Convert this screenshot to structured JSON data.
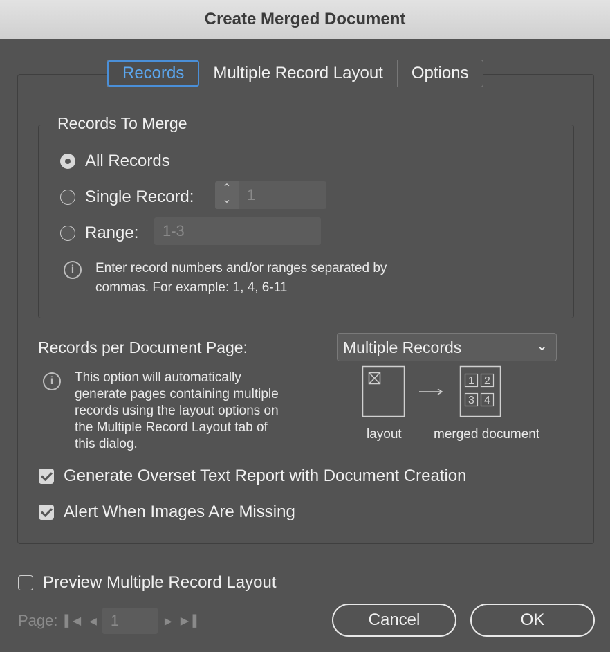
{
  "window": {
    "title": "Create Merged Document"
  },
  "tabs": [
    {
      "label": "Records",
      "active": true
    },
    {
      "label": "Multiple Record Layout",
      "active": false
    },
    {
      "label": "Options",
      "active": false
    }
  ],
  "records_group": {
    "title": "Records To Merge",
    "all_records": {
      "label": "All Records",
      "selected": true
    },
    "single_record": {
      "label": "Single Record:",
      "value": "1",
      "selected": false
    },
    "range": {
      "label": "Range:",
      "placeholder": "1-3",
      "selected": false
    },
    "info_line1": "Enter record numbers and/or ranges separated by",
    "info_line2": "commas. For example: 1, 4, 6-11"
  },
  "per_page": {
    "label": "Records per Document Page:",
    "selected": "Multiple Records",
    "info_lines": [
      "This option will automatically",
      "generate pages containing multiple",
      "records using the layout options on",
      "the Multiple Record Layout tab of",
      "this dialog."
    ],
    "diagram": {
      "layout_caption": "layout",
      "merged_caption": "merged document",
      "cells": [
        "1",
        "2",
        "3",
        "4"
      ]
    }
  },
  "checkboxes": {
    "overset": {
      "label": "Generate Overset Text Report with Document Creation",
      "checked": true
    },
    "images": {
      "label": "Alert When Images Are Missing",
      "checked": true
    },
    "preview": {
      "label": "Preview Multiple Record Layout",
      "checked": false
    }
  },
  "pager": {
    "label": "Page:",
    "value": "1"
  },
  "buttons": {
    "cancel": "Cancel",
    "ok": "OK"
  },
  "colors": {
    "accent": "#5ba6ee",
    "background": "#535353"
  }
}
